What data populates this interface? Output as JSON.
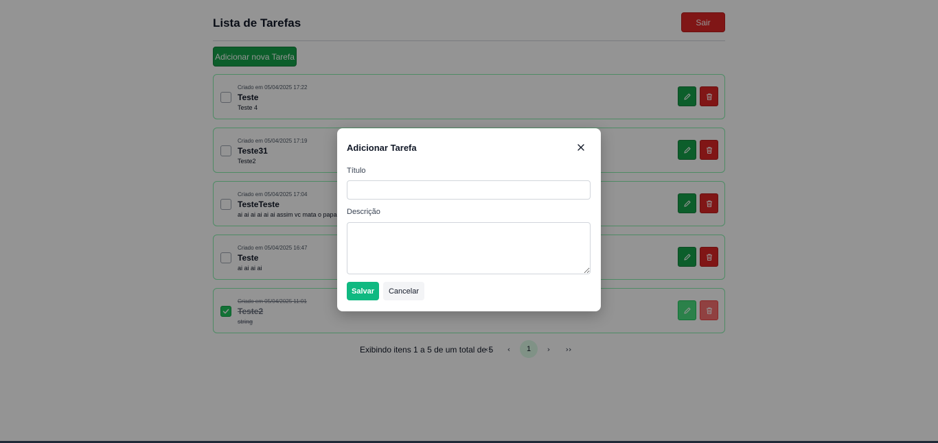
{
  "header": {
    "title": "Lista de Tarefas",
    "logout_label": "Sair"
  },
  "add_button_label": "Adicionar nova Tarefa",
  "tasks": [
    {
      "created": "Criado em 05/04/2025 17:22",
      "title": "Teste",
      "description": "Teste 4",
      "completed": false
    },
    {
      "created": "Criado em 05/04/2025 17:19",
      "title": "Teste31",
      "description": "Teste2",
      "completed": false
    },
    {
      "created": "Criado em 05/04/2025 17:04",
      "title": "TesteTeste",
      "description": "ai ai ai ai ai ai assim vc mata o papai",
      "completed": false
    },
    {
      "created": "Criado em 05/04/2025 16:47",
      "title": "Teste",
      "description": "ai ai ai ai",
      "completed": false
    },
    {
      "created": "Criado em 05/04/2025 11:01",
      "title": "Teste2",
      "description": "string",
      "completed": true
    }
  ],
  "pagination": {
    "info": "Exibindo itens 1 a 5 de um total de 5",
    "first": "‹‹",
    "prev": "‹",
    "current_page": "1",
    "next": "›",
    "last": "››"
  },
  "modal": {
    "title": "Adicionar Tarefa",
    "title_label": "Título",
    "title_value": "",
    "description_label": "Descrição",
    "description_value": "",
    "save_label": "Salvar",
    "cancel_label": "Cancelar"
  },
  "icons": {
    "edit": "pencil-icon",
    "delete": "trash-icon",
    "close": "close-icon",
    "check": "check-icon"
  },
  "colors": {
    "success": "#16a34a",
    "danger": "#dc2626",
    "save": "#10b981",
    "task_border": "#86efac"
  }
}
